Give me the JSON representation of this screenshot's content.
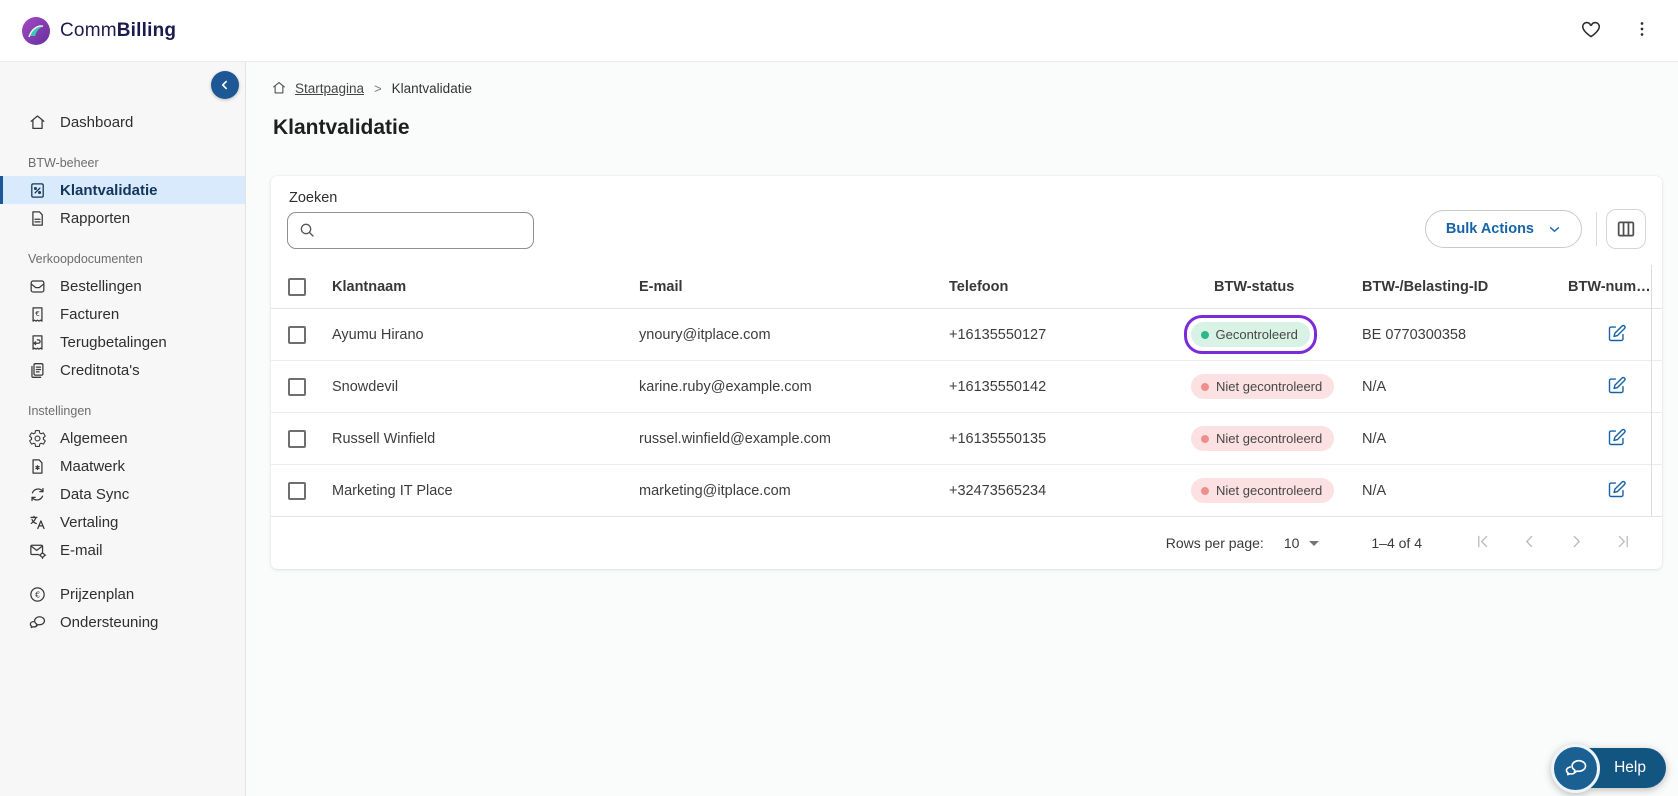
{
  "brand": {
    "comm": "Comm",
    "billing": "Billing"
  },
  "topbar": {
    "icons": [
      "favorites",
      "kebab-menu"
    ]
  },
  "sidebar": {
    "sections": [
      {
        "header": null,
        "items": [
          {
            "label": "Dashboard",
            "icon": "home"
          }
        ]
      },
      {
        "header": "BTW-beheer",
        "items": [
          {
            "label": "Klantvalidatie",
            "icon": "percent-doc",
            "active": true
          },
          {
            "label": "Rapporten",
            "icon": "doc-lines"
          }
        ]
      },
      {
        "header": "Verkoopdocumenten",
        "items": [
          {
            "label": "Bestellingen",
            "icon": "inbox"
          },
          {
            "label": "Facturen",
            "icon": "receipt-euro"
          },
          {
            "label": "Terugbetalingen",
            "icon": "receipt-return"
          },
          {
            "label": "Creditnota's",
            "icon": "copy-doc"
          }
        ]
      },
      {
        "header": "Instellingen",
        "items": [
          {
            "label": "Algemeen",
            "icon": "gear"
          },
          {
            "label": "Maatwerk",
            "icon": "doc-gear"
          },
          {
            "label": "Data Sync",
            "icon": "sync"
          },
          {
            "label": "Vertaling",
            "icon": "translate"
          },
          {
            "label": "E-mail",
            "icon": "mail-gear"
          }
        ]
      },
      {
        "header": null,
        "gap": true,
        "items": [
          {
            "label": "Prijzenplan",
            "icon": "euro-circle"
          },
          {
            "label": "Ondersteuning",
            "icon": "chat"
          }
        ]
      }
    ]
  },
  "breadcrumb": {
    "home_label": "Startpagina",
    "current": "Klantvalidatie"
  },
  "page": {
    "title": "Klantvalidatie"
  },
  "toolbar": {
    "search_label": "Zoeken",
    "search_value": "",
    "bulk_actions_label": "Bulk Actions"
  },
  "table": {
    "columns": [
      "Klantnaam",
      "E-mail",
      "Telefoon",
      "BTW-status",
      "BTW-/Belasting-ID",
      "BTW-num…"
    ],
    "rows": [
      {
        "name": "Ayumu Hirano",
        "email": "ynoury@itplace.com",
        "phone": "+16135550127",
        "status": "Gecontroleerd",
        "status_type": "verified",
        "vat_id": "BE 0770300358",
        "highlighted": true
      },
      {
        "name": "Snowdevil",
        "email": "karine.ruby@example.com",
        "phone": "+16135550142",
        "status": "Niet gecontroleerd",
        "status_type": "unverified",
        "vat_id": "N/A",
        "highlighted": false
      },
      {
        "name": "Russell Winfield",
        "email": "russel.winfield@example.com",
        "phone": "+16135550135",
        "status": "Niet gecontroleerd",
        "status_type": "unverified",
        "vat_id": "N/A",
        "highlighted": false
      },
      {
        "name": "Marketing IT Place",
        "email": "marketing@itplace.com",
        "phone": "+32473565234",
        "status": "Niet gecontroleerd",
        "status_type": "unverified",
        "vat_id": "N/A",
        "highlighted": false
      }
    ]
  },
  "pagination": {
    "rows_per_page_label": "Rows per page:",
    "rows_per_page_value": "10",
    "range_label": "1–4 of 4",
    "controls": [
      "first-page",
      "previous-page",
      "next-page",
      "last-page"
    ]
  },
  "help": {
    "label": "Help"
  },
  "colors": {
    "accent": "#1664a7",
    "active_item_bg": "#d8eafc",
    "active_item_bar": "#1c5796",
    "verified_bg": "#d9f2e6",
    "verified_dot": "#2fb78c",
    "unverified_bg": "#fbe1e1",
    "unverified_dot": "#ee8f8f",
    "ring": "#7c2bd9",
    "help_bg": "#135581"
  }
}
